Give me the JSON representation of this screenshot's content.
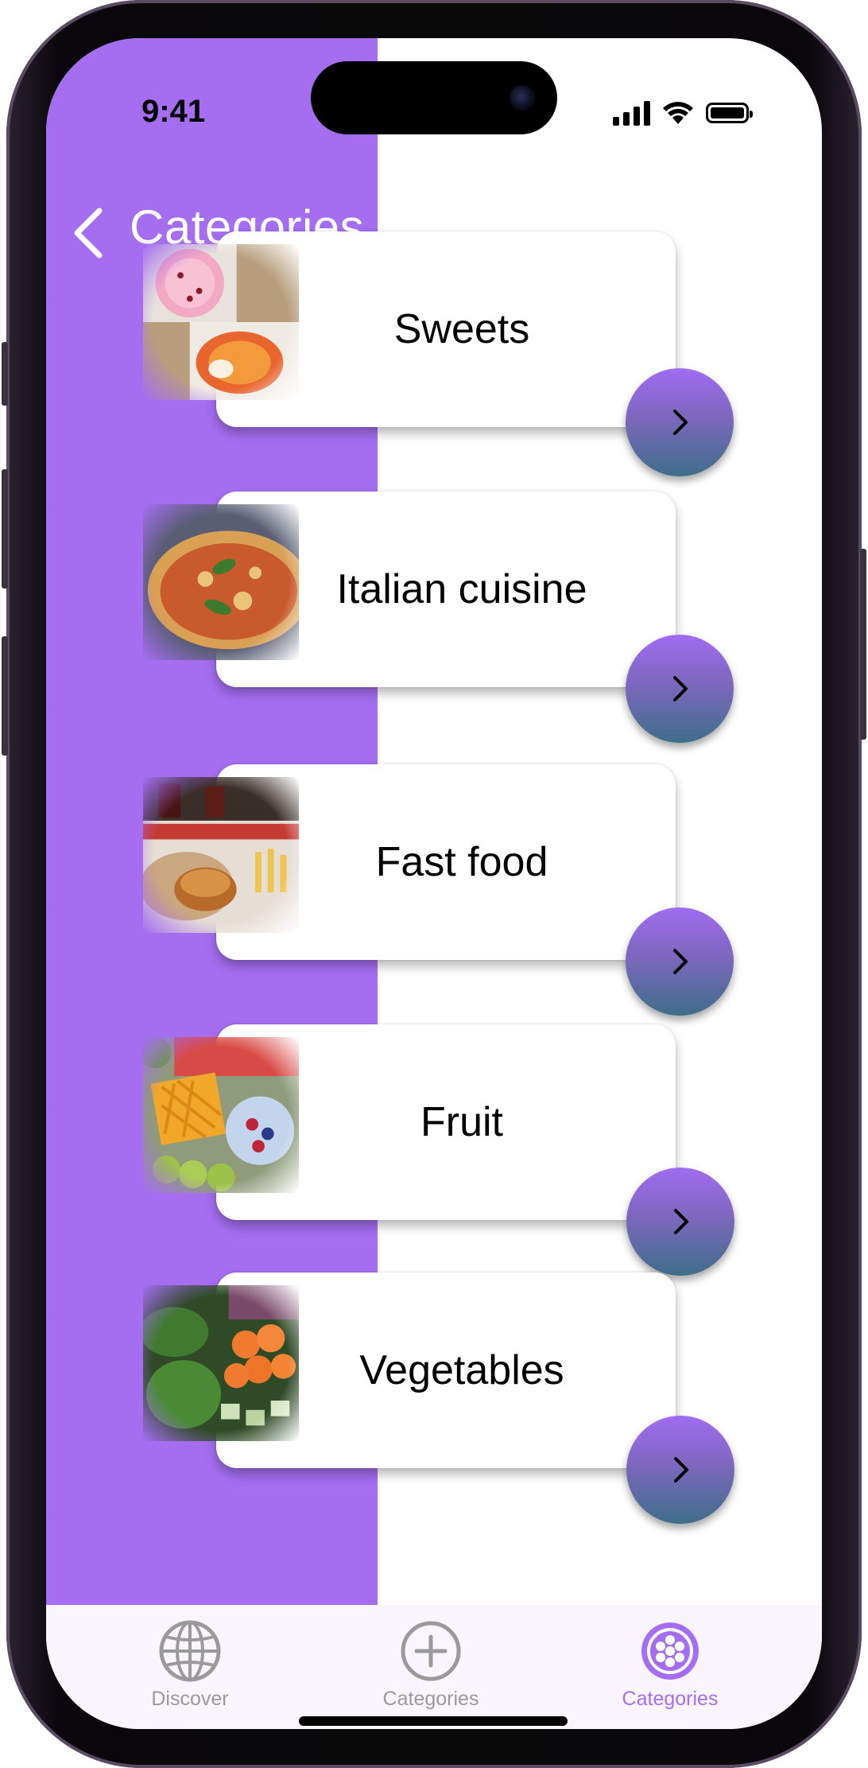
{
  "status_bar": {
    "time": "9:41"
  },
  "nav": {
    "title": "Categories",
    "back_icon": "chevron-left-icon"
  },
  "categories": [
    {
      "label": "Sweets",
      "image": "cakes-photo"
    },
    {
      "label": "Italian cuisine",
      "image": "pizza-photo"
    },
    {
      "label": "Fast food",
      "image": "burger-fries-photo"
    },
    {
      "label": "Fruit",
      "image": "fruit-platter-photo"
    },
    {
      "label": "Vegetables",
      "image": "vegetables-photo"
    }
  ],
  "tabbar": {
    "items": [
      {
        "label": "Discover",
        "icon": "globe-icon",
        "selected": false
      },
      {
        "label": "Categories",
        "icon": "plus-circle-icon",
        "selected": false
      },
      {
        "label": "Categories",
        "icon": "grid-dots-icon",
        "selected": true
      }
    ]
  },
  "colors": {
    "accent": "#a56ef1",
    "button_top": "#a06cf0",
    "button_bottom": "#3e6e8a",
    "tab_inactive": "#9a9a9a",
    "tab_active": "#a56ef1"
  }
}
